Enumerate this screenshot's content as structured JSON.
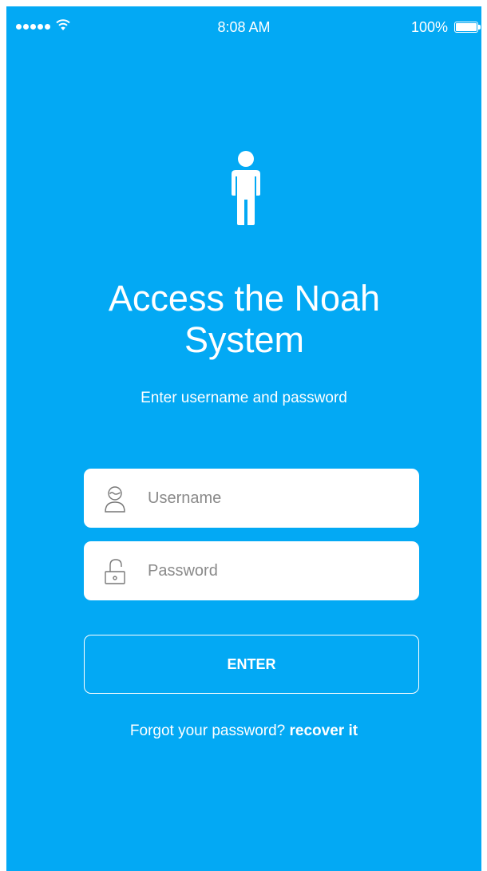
{
  "status_bar": {
    "time": "8:08 AM",
    "battery_percent": "100%",
    "signal_icon": "signal-dots-icon",
    "wifi_icon": "wifi-icon",
    "battery_icon": "battery-icon"
  },
  "header": {
    "icon": "person-icon",
    "title": "Access the Noah System",
    "subtitle": "Enter username and password"
  },
  "form": {
    "username": {
      "placeholder": "Username",
      "value": "",
      "icon": "user-icon"
    },
    "password": {
      "placeholder": "Password",
      "value": "",
      "icon": "lock-icon"
    },
    "submit_label": "ENTER"
  },
  "footer": {
    "forgot_text": "Forgot your password?",
    "recover_link": "recover it"
  },
  "colors": {
    "background": "#03a9f4",
    "field_background": "#ffffff",
    "text": "#ffffff"
  }
}
